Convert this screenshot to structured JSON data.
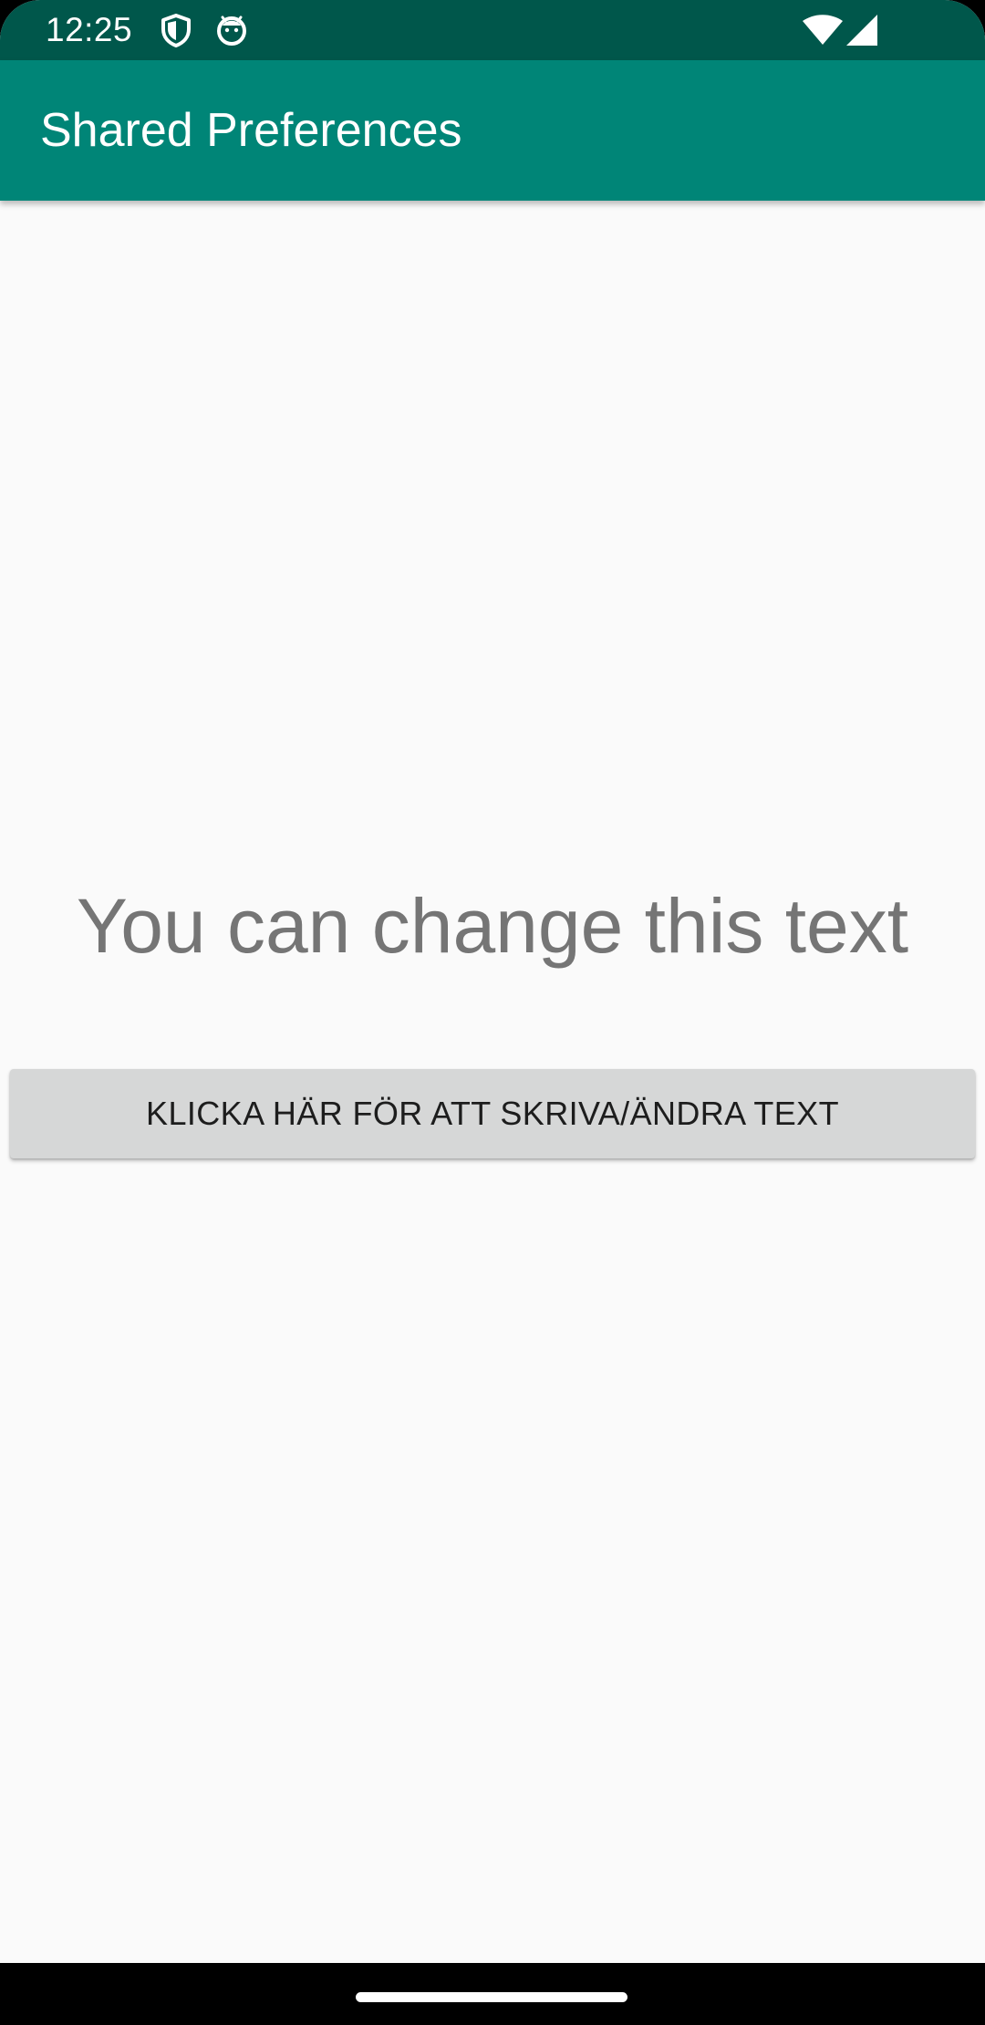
{
  "status_bar": {
    "time": "12:25",
    "icons": [
      "shield-icon",
      "android-debug-icon",
      "wifi-icon",
      "cell-signal-icon"
    ]
  },
  "app_bar": {
    "title": "Shared Preferences",
    "color": "#008577",
    "status_color": "#00574b"
  },
  "main": {
    "text": "You can change this text",
    "button_label": "KLICKA HÄR FÖR ATT SKRIVA/ÄNDRA TEXT"
  },
  "nav_bar": {
    "handle": "home-handle"
  }
}
